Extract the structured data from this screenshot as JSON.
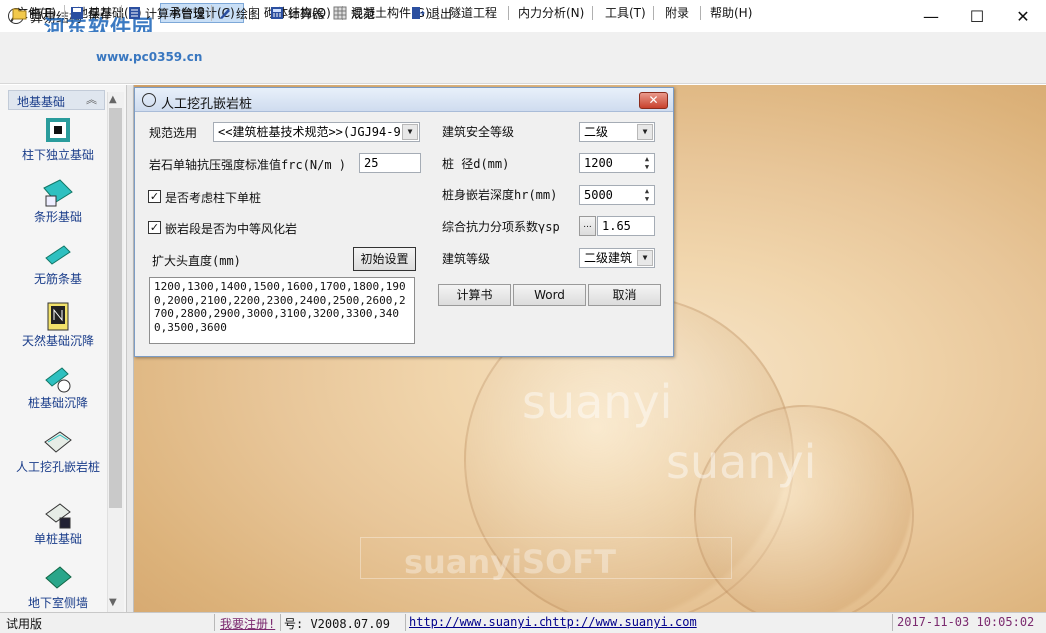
{
  "window": {
    "title": "算易结构",
    "controls": [
      "—",
      "☐",
      "✕"
    ]
  },
  "watermark": {
    "text": "河东软件园",
    "url": "www.pc0359.cn"
  },
  "menu": {
    "items": [
      "文件(F)",
      "地基基础(B)",
      "承台设计(C)",
      "砌体结构(Q)",
      "混凝土构件(G)",
      "隧道工程",
      "内力分析(N)",
      "工具(T)",
      "附录",
      "帮助(H)"
    ]
  },
  "toolbar": {
    "open": "打开",
    "save": "保存",
    "report_manager": "计算书管理",
    "draw": "绘图",
    "calculator": "计算器",
    "spec": "规范",
    "exit": "退出"
  },
  "sidebar": {
    "header": "地基基础",
    "items": [
      {
        "label": "柱下独立基础"
      },
      {
        "label": "条形基础"
      },
      {
        "label": "无筋条基"
      },
      {
        "label": "天然基础沉降"
      },
      {
        "label": "桩基础沉降"
      },
      {
        "label": "人工挖孔嵌岩桩"
      },
      {
        "label": "单桩基础"
      },
      {
        "label": "地下室侧墙"
      }
    ]
  },
  "dialog": {
    "title": "人工挖孔嵌岩桩",
    "spec_label": "规范选用",
    "spec_value": "<<建筑桩基技术规范>>(JGJ94-9",
    "rock_label": "岩石单轴抗压强度标准值frc(N/m  )",
    "rock_value": "25",
    "chk_single_pile": "是否考虑柱下单桩",
    "chk_weathered": "嵌岩段是否为中等风化岩",
    "enlarged_label": "扩大头直度(mm)",
    "init_button": "初始设置",
    "diameters": "1200,1300,1400,1500,1600,1700,1800,1900,2000,2100,2200,2300,2400,2500,2600,2700,2800,2900,3000,3100,3200,3300,3400,3500,3600",
    "safety_label": "建筑安全等级",
    "safety_value": "二级",
    "pile_d_label": "桩  径d(mm)",
    "pile_d_value": "1200",
    "embed_label": "桩身嵌岩深度hr(mm)",
    "embed_value": "5000",
    "factor_label": "综合抗力分项系数γsp",
    "factor_value": "1.65",
    "grade_label": "建筑等级",
    "grade_value": "二级建筑",
    "btn_report": "计算书",
    "btn_word": "Word",
    "btn_cancel": "取消"
  },
  "background": {
    "text1": "suanyi",
    "text2": "suanyi",
    "text3": "suanyiSOFT"
  },
  "status": {
    "trial": "试用版",
    "register": "我要注册!",
    "version": "号: V2008.07.09",
    "url1": "http://www.suanyi.com",
    "url2": "http://www.suanyi.com",
    "datetime": "2017-11-03 10:05:02"
  },
  "colors": {
    "accent": "#1a3d8a",
    "dialog_close": "#c8412d",
    "workspace": "#e8c699"
  }
}
